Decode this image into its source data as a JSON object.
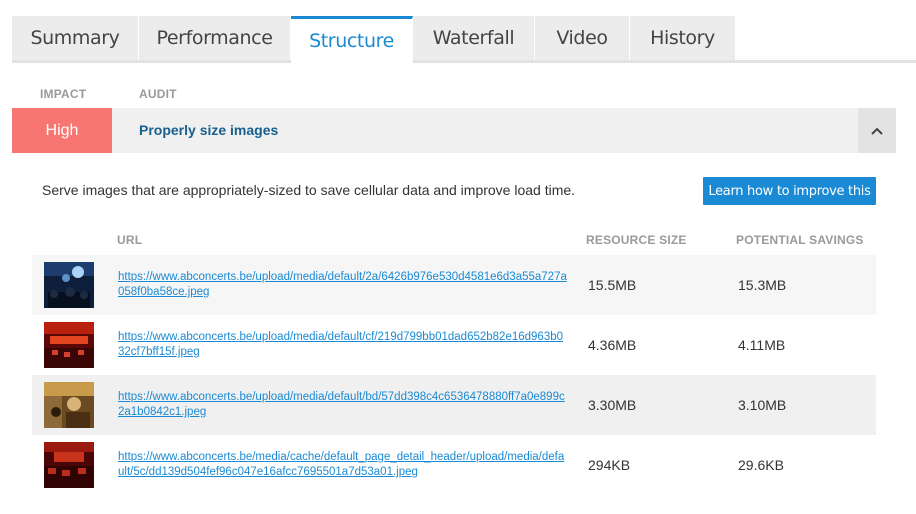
{
  "tabs": [
    {
      "label": "Summary"
    },
    {
      "label": "Performance"
    },
    {
      "label": "Structure"
    },
    {
      "label": "Waterfall"
    },
    {
      "label": "Video"
    },
    {
      "label": "History"
    }
  ],
  "active_tab": "Structure",
  "header": {
    "impact_label": "IMPACT",
    "audit_label": "AUDIT"
  },
  "audit": {
    "impact": "High",
    "title": "Properly size images",
    "description": "Serve images that are appropriately-sized to save cellular data and improve load time.",
    "learn_button": "Learn how to improve this",
    "collapse_icon": "chevron-up-icon"
  },
  "table": {
    "columns": {
      "url": "URL",
      "resource_size": "RESOURCE SIZE",
      "potential_savings": "POTENTIAL SAVINGS"
    },
    "rows": [
      {
        "url": "https://www.abconcerts.be/upload/media/default/2a/6426b976e530d4581e6d3a55a727a058f0ba58ce.jpeg",
        "resource_size": "15.5MB",
        "potential_savings": "15.3MB"
      },
      {
        "url": "https://www.abconcerts.be/upload/media/default/cf/219d799bb01dad652b82e16d963b032cf7bff15f.jpeg",
        "resource_size": "4.36MB",
        "potential_savings": "4.11MB"
      },
      {
        "url": "https://www.abconcerts.be/upload/media/default/bd/57dd398c4c6536478880ff7a0e899c2a1b0842c1.jpeg",
        "resource_size": "3.30MB",
        "potential_savings": "3.10MB"
      },
      {
        "url": "https://www.abconcerts.be/media/cache/default_page_detail_header/upload/media/default/5c/dd139d504fef96c047e16afcc7695501a7d53a01.jpeg",
        "resource_size": "294KB",
        "potential_savings": "29.6KB"
      }
    ]
  },
  "colors": {
    "accent": "#1a8ad4",
    "impact_high": "#f87671",
    "audit_title": "#18608f"
  }
}
